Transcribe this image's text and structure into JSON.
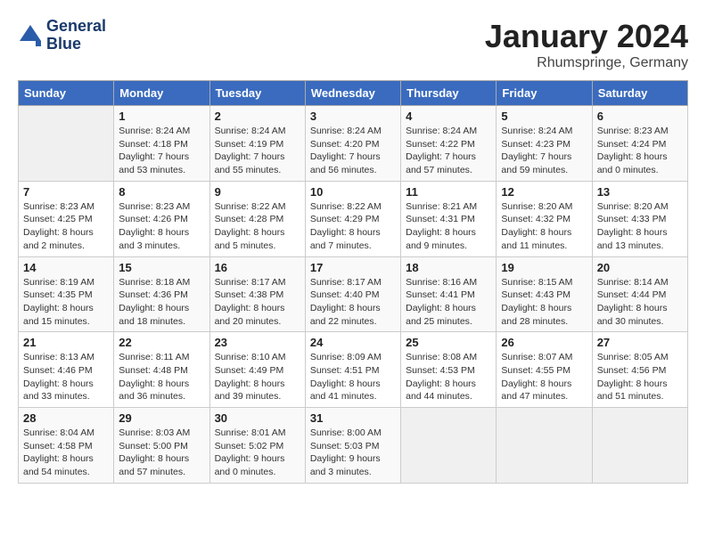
{
  "header": {
    "logo_line1": "General",
    "logo_line2": "Blue",
    "month_title": "January 2024",
    "location": "Rhumspringe, Germany"
  },
  "weekdays": [
    "Sunday",
    "Monday",
    "Tuesday",
    "Wednesday",
    "Thursday",
    "Friday",
    "Saturday"
  ],
  "weeks": [
    [
      {
        "day": "",
        "empty": true
      },
      {
        "day": "1",
        "sunrise": "Sunrise: 8:24 AM",
        "sunset": "Sunset: 4:18 PM",
        "daylight": "Daylight: 7 hours and 53 minutes."
      },
      {
        "day": "2",
        "sunrise": "Sunrise: 8:24 AM",
        "sunset": "Sunset: 4:19 PM",
        "daylight": "Daylight: 7 hours and 55 minutes."
      },
      {
        "day": "3",
        "sunrise": "Sunrise: 8:24 AM",
        "sunset": "Sunset: 4:20 PM",
        "daylight": "Daylight: 7 hours and 56 minutes."
      },
      {
        "day": "4",
        "sunrise": "Sunrise: 8:24 AM",
        "sunset": "Sunset: 4:22 PM",
        "daylight": "Daylight: 7 hours and 57 minutes."
      },
      {
        "day": "5",
        "sunrise": "Sunrise: 8:24 AM",
        "sunset": "Sunset: 4:23 PM",
        "daylight": "Daylight: 7 hours and 59 minutes."
      },
      {
        "day": "6",
        "sunrise": "Sunrise: 8:23 AM",
        "sunset": "Sunset: 4:24 PM",
        "daylight": "Daylight: 8 hours and 0 minutes."
      }
    ],
    [
      {
        "day": "7",
        "sunrise": "Sunrise: 8:23 AM",
        "sunset": "Sunset: 4:25 PM",
        "daylight": "Daylight: 8 hours and 2 minutes."
      },
      {
        "day": "8",
        "sunrise": "Sunrise: 8:23 AM",
        "sunset": "Sunset: 4:26 PM",
        "daylight": "Daylight: 8 hours and 3 minutes."
      },
      {
        "day": "9",
        "sunrise": "Sunrise: 8:22 AM",
        "sunset": "Sunset: 4:28 PM",
        "daylight": "Daylight: 8 hours and 5 minutes."
      },
      {
        "day": "10",
        "sunrise": "Sunrise: 8:22 AM",
        "sunset": "Sunset: 4:29 PM",
        "daylight": "Daylight: 8 hours and 7 minutes."
      },
      {
        "day": "11",
        "sunrise": "Sunrise: 8:21 AM",
        "sunset": "Sunset: 4:31 PM",
        "daylight": "Daylight: 8 hours and 9 minutes."
      },
      {
        "day": "12",
        "sunrise": "Sunrise: 8:20 AM",
        "sunset": "Sunset: 4:32 PM",
        "daylight": "Daylight: 8 hours and 11 minutes."
      },
      {
        "day": "13",
        "sunrise": "Sunrise: 8:20 AM",
        "sunset": "Sunset: 4:33 PM",
        "daylight": "Daylight: 8 hours and 13 minutes."
      }
    ],
    [
      {
        "day": "14",
        "sunrise": "Sunrise: 8:19 AM",
        "sunset": "Sunset: 4:35 PM",
        "daylight": "Daylight: 8 hours and 15 minutes."
      },
      {
        "day": "15",
        "sunrise": "Sunrise: 8:18 AM",
        "sunset": "Sunset: 4:36 PM",
        "daylight": "Daylight: 8 hours and 18 minutes."
      },
      {
        "day": "16",
        "sunrise": "Sunrise: 8:17 AM",
        "sunset": "Sunset: 4:38 PM",
        "daylight": "Daylight: 8 hours and 20 minutes."
      },
      {
        "day": "17",
        "sunrise": "Sunrise: 8:17 AM",
        "sunset": "Sunset: 4:40 PM",
        "daylight": "Daylight: 8 hours and 22 minutes."
      },
      {
        "day": "18",
        "sunrise": "Sunrise: 8:16 AM",
        "sunset": "Sunset: 4:41 PM",
        "daylight": "Daylight: 8 hours and 25 minutes."
      },
      {
        "day": "19",
        "sunrise": "Sunrise: 8:15 AM",
        "sunset": "Sunset: 4:43 PM",
        "daylight": "Daylight: 8 hours and 28 minutes."
      },
      {
        "day": "20",
        "sunrise": "Sunrise: 8:14 AM",
        "sunset": "Sunset: 4:44 PM",
        "daylight": "Daylight: 8 hours and 30 minutes."
      }
    ],
    [
      {
        "day": "21",
        "sunrise": "Sunrise: 8:13 AM",
        "sunset": "Sunset: 4:46 PM",
        "daylight": "Daylight: 8 hours and 33 minutes."
      },
      {
        "day": "22",
        "sunrise": "Sunrise: 8:11 AM",
        "sunset": "Sunset: 4:48 PM",
        "daylight": "Daylight: 8 hours and 36 minutes."
      },
      {
        "day": "23",
        "sunrise": "Sunrise: 8:10 AM",
        "sunset": "Sunset: 4:49 PM",
        "daylight": "Daylight: 8 hours and 39 minutes."
      },
      {
        "day": "24",
        "sunrise": "Sunrise: 8:09 AM",
        "sunset": "Sunset: 4:51 PM",
        "daylight": "Daylight: 8 hours and 41 minutes."
      },
      {
        "day": "25",
        "sunrise": "Sunrise: 8:08 AM",
        "sunset": "Sunset: 4:53 PM",
        "daylight": "Daylight: 8 hours and 44 minutes."
      },
      {
        "day": "26",
        "sunrise": "Sunrise: 8:07 AM",
        "sunset": "Sunset: 4:55 PM",
        "daylight": "Daylight: 8 hours and 47 minutes."
      },
      {
        "day": "27",
        "sunrise": "Sunrise: 8:05 AM",
        "sunset": "Sunset: 4:56 PM",
        "daylight": "Daylight: 8 hours and 51 minutes."
      }
    ],
    [
      {
        "day": "28",
        "sunrise": "Sunrise: 8:04 AM",
        "sunset": "Sunset: 4:58 PM",
        "daylight": "Daylight: 8 hours and 54 minutes."
      },
      {
        "day": "29",
        "sunrise": "Sunrise: 8:03 AM",
        "sunset": "Sunset: 5:00 PM",
        "daylight": "Daylight: 8 hours and 57 minutes."
      },
      {
        "day": "30",
        "sunrise": "Sunrise: 8:01 AM",
        "sunset": "Sunset: 5:02 PM",
        "daylight": "Daylight: 9 hours and 0 minutes."
      },
      {
        "day": "31",
        "sunrise": "Sunrise: 8:00 AM",
        "sunset": "Sunset: 5:03 PM",
        "daylight": "Daylight: 9 hours and 3 minutes."
      },
      {
        "day": "",
        "empty": true
      },
      {
        "day": "",
        "empty": true
      },
      {
        "day": "",
        "empty": true
      }
    ]
  ]
}
